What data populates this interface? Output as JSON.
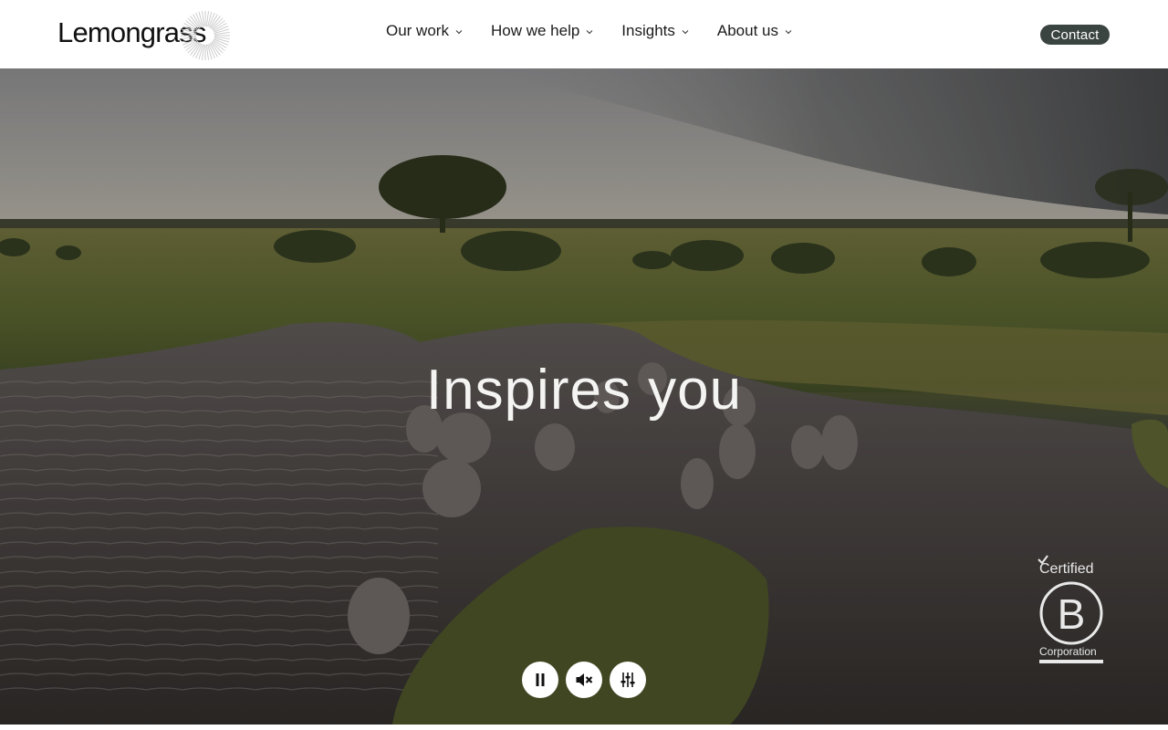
{
  "header": {
    "logo_text": "Lemongrass",
    "nav": [
      {
        "label": "Our work"
      },
      {
        "label": "How we help"
      },
      {
        "label": "Insights"
      },
      {
        "label": "About us"
      }
    ],
    "contact_label": "Contact"
  },
  "hero": {
    "title": "Inspires you",
    "controls": {
      "pause_icon": "pause-icon",
      "mute_icon": "mute-icon",
      "settings_icon": "sliders-icon"
    },
    "badge": {
      "certified": "Certified",
      "letter": "B",
      "corporation": "Corporation"
    }
  },
  "colors": {
    "contact_bg": "#3a4440",
    "title_text": "#f4f4f2",
    "control_bg": "#ffffff"
  }
}
